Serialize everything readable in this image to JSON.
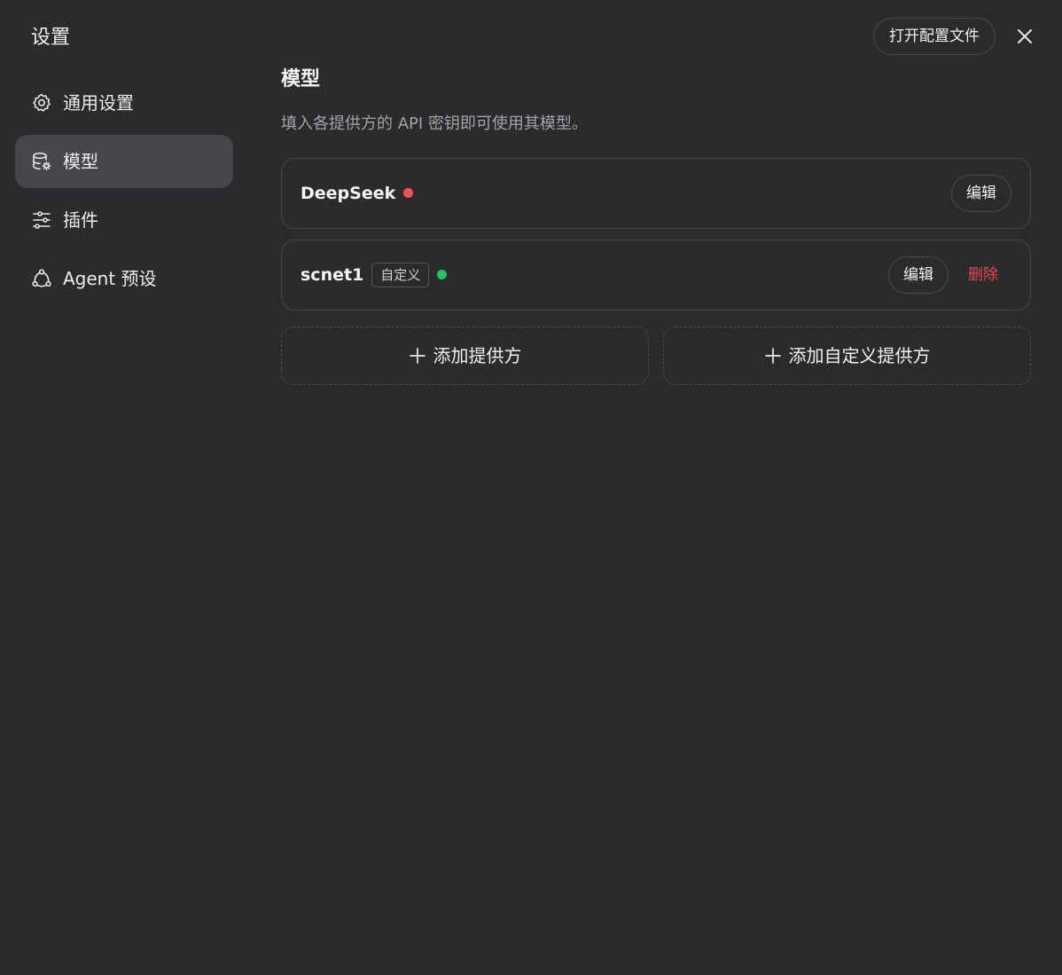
{
  "dialog": {
    "title": "设置",
    "open_config_label": "打开配置文件",
    "close_icon": "close-icon"
  },
  "sidebar": {
    "items": [
      {
        "label": "通用设置",
        "icon": "gear-icon",
        "active": false
      },
      {
        "label": "模型",
        "icon": "database-gear-icon",
        "active": true
      },
      {
        "label": "插件",
        "icon": "sliders-icon",
        "active": false
      },
      {
        "label": "Agent 预设",
        "icon": "agent-nodes-icon",
        "active": false
      }
    ]
  },
  "main": {
    "title": "模型",
    "description": "填入各提供方的 API 密钥即可使用其模型。",
    "providers": [
      {
        "name": "DeepSeek",
        "tag": "",
        "status": "error",
        "status_color": "#ef5350",
        "edit_label": "编辑",
        "delete_label": ""
      },
      {
        "name": "scnet1",
        "tag": "自定义",
        "status": "ok",
        "status_color": "#22c55e",
        "edit_label": "编辑",
        "delete_label": "删除"
      }
    ],
    "add_provider_label": "添加提供方",
    "add_custom_provider_label": "添加自定义提供方"
  },
  "colors": {
    "background": "#2b2b2d",
    "active_nav": "#46464b",
    "danger": "#e5484d",
    "success": "#22c55e"
  }
}
